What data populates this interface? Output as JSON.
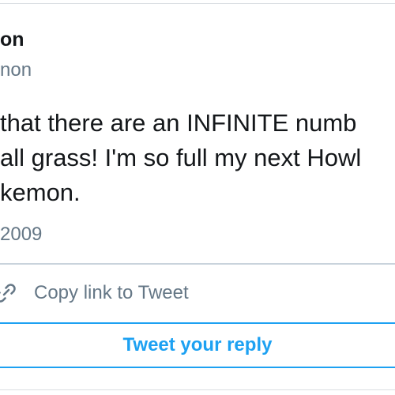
{
  "tweet": {
    "author_name": "on",
    "author_handle": "non",
    "text_lines": [
      "that there are an INFINITE numb",
      "all grass! I'm so full my next Howl",
      "kemon."
    ],
    "date": "2009"
  },
  "actions": {
    "copy_link_label": "Copy link to Tweet",
    "copy_link_icon": "link-icon",
    "reply_label": "Tweet your reply"
  },
  "colors": {
    "text": "#14171a",
    "secondary": "#657786",
    "accent": "#1da1f2",
    "divider": "#c9d3dc"
  }
}
